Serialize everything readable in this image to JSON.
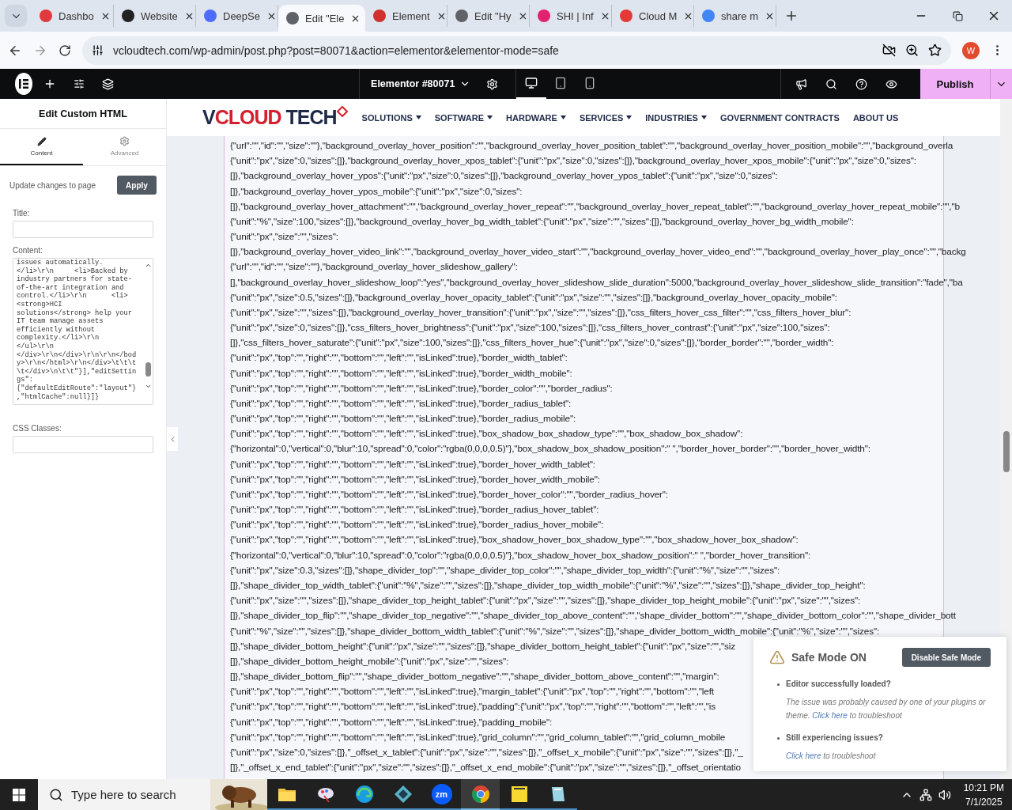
{
  "browser": {
    "tabs": [
      {
        "label": "Dashbo",
        "color": "#e0393e",
        "selected": false
      },
      {
        "label": "Website",
        "color": "#222222",
        "selected": false
      },
      {
        "label": "DeepSe",
        "color": "#4d6bfe",
        "selected": false
      },
      {
        "label": "Edit \"Ele",
        "color": "#5f6368",
        "selected": true
      },
      {
        "label": "Element",
        "color": "#d0312d",
        "selected": false
      },
      {
        "label": "Edit \"Hy",
        "color": "#5f6368",
        "selected": false
      },
      {
        "label": "SHI | Inf",
        "color": "#e2226f",
        "selected": false
      },
      {
        "label": "Cloud M",
        "color": "#e53935",
        "selected": false
      },
      {
        "label": "share m",
        "color": "#4285f4",
        "selected": false
      }
    ],
    "url": "vcloudtech.com/wp-admin/post.php?post=80071&action=elementor&elementor-mode=safe",
    "avatar": "W"
  },
  "editor_bar": {
    "document": "Elementor #80071",
    "devices": [
      {
        "kind": "desktop",
        "selected": true
      },
      {
        "kind": "tablet",
        "selected": false
      },
      {
        "kind": "mobile",
        "selected": false
      }
    ],
    "publish": "Publish"
  },
  "panel": {
    "title": "Edit Custom HTML",
    "tabs": [
      {
        "label": "Content",
        "kind": "pencil",
        "selected": true
      },
      {
        "label": "Advanced",
        "kind": "gear",
        "selected": false
      }
    ],
    "update_label": "Update changes to page",
    "apply": "Apply",
    "title_label": "Title:",
    "content_label": "Content:",
    "content_lines": [
      "issues automatically.",
      "</li>\\r\\n     <li>Backed by",
      "industry partners for state-",
      "of-the-art integration and",
      "control.</li>\\r\\n      <li>",
      "<strong>HCI",
      "solutions</strong> help your",
      "IT team manage assets",
      "efficiently without",
      "complexity.</li>\\r\\n",
      "</ul>\\r\\n",
      "</div>\\r\\n</div>\\r\\n\\r\\n</bod",
      "y>\\r\\n</html>\\r\\n</div>\\t\\t\\t",
      "\\t</div>\\n\\t\\t\"}],\"editSettin",
      "gs\":",
      "{\"defaultEditRoute\":\"layout\"}",
      ",\"htmlCache\":null}]}"
    ],
    "css_label": "CSS Classes:"
  },
  "site": {
    "logo": [
      {
        "text": "V",
        "color": "#1f2a48"
      },
      {
        "text": "CLOUD",
        "color": "#d4202e"
      },
      {
        "text": " TECH",
        "color": "#1f2a48"
      }
    ],
    "nav": [
      {
        "label": "SOLUTIONS",
        "dropdown": true
      },
      {
        "label": "SOFTWARE",
        "dropdown": true
      },
      {
        "label": "HARDWARE",
        "dropdown": true
      },
      {
        "label": "SERVICES",
        "dropdown": true
      },
      {
        "label": "INDUSTRIES",
        "dropdown": true
      },
      {
        "label": "GOVERNMENT CONTRACTS",
        "dropdown": false
      },
      {
        "label": "ABOUT US",
        "dropdown": false
      }
    ],
    "code_lines": [
      "{\"url\":\"\",\"id\":\"\",\"size\":\"\"},\"background_overlay_hover_position\":\"\",\"background_overlay_hover_position_tablet\":\"\",\"background_overlay_hover_position_mobile\":\"\",\"background_overla",
      "{\"unit\":\"px\",\"size\":0,\"sizes\":[]},\"background_overlay_hover_xpos_tablet\":{\"unit\":\"px\",\"size\":0,\"sizes\":[]},\"background_overlay_hover_xpos_mobile\":{\"unit\":\"px\",\"size\":0,\"sizes\":",
      "[]},\"background_overlay_hover_ypos\":{\"unit\":\"px\",\"size\":0,\"sizes\":[]},\"background_overlay_hover_ypos_tablet\":{\"unit\":\"px\",\"size\":0,\"sizes\":",
      "[]},\"background_overlay_hover_ypos_mobile\":{\"unit\":\"px\",\"size\":0,\"sizes\":",
      "[]},\"background_overlay_hover_attachment\":\"\",\"background_overlay_hover_repeat\":\"\",\"background_overlay_hover_repeat_tablet\":\"\",\"background_overlay_hover_repeat_mobile\":\"\",\"b",
      "{\"unit\":\"%\",\"size\":100,\"sizes\":[]},\"background_overlay_hover_bg_width_tablet\":{\"unit\":\"px\",\"size\":\"\",\"sizes\":[]},\"background_overlay_hover_bg_width_mobile\":",
      "{\"unit\":\"px\",\"size\":\"\",\"sizes\":",
      "[]},\"background_overlay_hover_video_link\":\"\",\"background_overlay_hover_video_start\":\"\",\"background_overlay_hover_video_end\":\"\",\"background_overlay_hover_play_once\":\"\",\"backg",
      "{\"url\":\"\",\"id\":\"\",\"size\":\"\"},\"background_overlay_hover_slideshow_gallery\":",
      "[],\"background_overlay_hover_slideshow_loop\":\"yes\",\"background_overlay_hover_slideshow_slide_duration\":5000,\"background_overlay_hover_slideshow_slide_transition\":\"fade\",\"ba",
      "{\"unit\":\"px\",\"size\":0.5,\"sizes\":[]},\"background_overlay_hover_opacity_tablet\":{\"unit\":\"px\",\"size\":\"\",\"sizes\":[]},\"background_overlay_hover_opacity_mobile\":",
      "{\"unit\":\"px\",\"size\":\"\",\"sizes\":[]},\"background_overlay_hover_transition\":{\"unit\":\"px\",\"size\":\"\",\"sizes\":[]},\"css_filters_hover_css_filter\":\"\",\"css_filters_hover_blur\":",
      "{\"unit\":\"px\",\"size\":0,\"sizes\":[]},\"css_filters_hover_brightness\":{\"unit\":\"px\",\"size\":100,\"sizes\":[]},\"css_filters_hover_contrast\":{\"unit\":\"px\",\"size\":100,\"sizes\":",
      "[]},\"css_filters_hover_saturate\":{\"unit\":\"px\",\"size\":100,\"sizes\":[]},\"css_filters_hover_hue\":{\"unit\":\"px\",\"size\":0,\"sizes\":[]},\"border_border\":\"\",\"border_width\":",
      "{\"unit\":\"px\",\"top\":\"\",\"right\":\"\",\"bottom\":\"\",\"left\":\"\",\"isLinked\":true},\"border_width_tablet\":",
      "{\"unit\":\"px\",\"top\":\"\",\"right\":\"\",\"bottom\":\"\",\"left\":\"\",\"isLinked\":true},\"border_width_mobile\":",
      "{\"unit\":\"px\",\"top\":\"\",\"right\":\"\",\"bottom\":\"\",\"left\":\"\",\"isLinked\":true},\"border_color\":\"\",\"border_radius\":",
      "{\"unit\":\"px\",\"top\":\"\",\"right\":\"\",\"bottom\":\"\",\"left\":\"\",\"isLinked\":true},\"border_radius_tablet\":",
      "{\"unit\":\"px\",\"top\":\"\",\"right\":\"\",\"bottom\":\"\",\"left\":\"\",\"isLinked\":true},\"border_radius_mobile\":",
      "{\"unit\":\"px\",\"top\":\"\",\"right\":\"\",\"bottom\":\"\",\"left\":\"\",\"isLinked\":true},\"box_shadow_box_shadow_type\":\"\",\"box_shadow_box_shadow\":",
      "{\"horizontal\":0,\"vertical\":0,\"blur\":10,\"spread\":0,\"color\":\"rgba(0,0,0,0.5)\"},\"box_shadow_box_shadow_position\":\" \",\"border_hover_border\":\"\",\"border_hover_width\":",
      "{\"unit\":\"px\",\"top\":\"\",\"right\":\"\",\"bottom\":\"\",\"left\":\"\",\"isLinked\":true},\"border_hover_width_tablet\":",
      "{\"unit\":\"px\",\"top\":\"\",\"right\":\"\",\"bottom\":\"\",\"left\":\"\",\"isLinked\":true},\"border_hover_width_mobile\":",
      "{\"unit\":\"px\",\"top\":\"\",\"right\":\"\",\"bottom\":\"\",\"left\":\"\",\"isLinked\":true},\"border_hover_color\":\"\",\"border_radius_hover\":",
      "{\"unit\":\"px\",\"top\":\"\",\"right\":\"\",\"bottom\":\"\",\"left\":\"\",\"isLinked\":true},\"border_radius_hover_tablet\":",
      "{\"unit\":\"px\",\"top\":\"\",\"right\":\"\",\"bottom\":\"\",\"left\":\"\",\"isLinked\":true},\"border_radius_hover_mobile\":",
      "{\"unit\":\"px\",\"top\":\"\",\"right\":\"\",\"bottom\":\"\",\"left\":\"\",\"isLinked\":true},\"box_shadow_hover_box_shadow_type\":\"\",\"box_shadow_hover_box_shadow\":",
      "{\"horizontal\":0,\"vertical\":0,\"blur\":10,\"spread\":0,\"color\":\"rgba(0,0,0,0.5)\"},\"box_shadow_hover_box_shadow_position\":\" \",\"border_hover_transition\":",
      "{\"unit\":\"px\",\"size\":0.3,\"sizes\":[]},\"shape_divider_top\":\"\",\"shape_divider_top_color\":\"\",\"shape_divider_top_width\":{\"unit\":\"%\",\"size\":\"\",\"sizes\":",
      "[]},\"shape_divider_top_width_tablet\":{\"unit\":\"%\",\"size\":\"\",\"sizes\":[]},\"shape_divider_top_width_mobile\":{\"unit\":\"%\",\"size\":\"\",\"sizes\":[]},\"shape_divider_top_height\":",
      "{\"unit\":\"px\",\"size\":\"\",\"sizes\":[]},\"shape_divider_top_height_tablet\":{\"unit\":\"px\",\"size\":\"\",\"sizes\":[]},\"shape_divider_top_height_mobile\":{\"unit\":\"px\",\"size\":\"\",\"sizes\":",
      "[]},\"shape_divider_top_flip\":\"\",\"shape_divider_top_negative\":\"\",\"shape_divider_top_above_content\":\"\",\"shape_divider_bottom\":\"\",\"shape_divider_bottom_color\":\"\",\"shape_divider_bott",
      "{\"unit\":\"%\",\"size\":\"\",\"sizes\":[]},\"shape_divider_bottom_width_tablet\":{\"unit\":\"%\",\"size\":\"\",\"sizes\":[]},\"shape_divider_bottom_width_mobile\":{\"unit\":\"%\",\"size\":\"\",\"sizes\":",
      "[]},\"shape_divider_bottom_height\":{\"unit\":\"px\",\"size\":\"\",\"sizes\":[]},\"shape_divider_bottom_height_tablet\":{\"unit\":\"px\",\"size\":\"\",\"siz",
      "[]},\"shape_divider_bottom_height_mobile\":{\"unit\":\"px\",\"size\":\"\",\"sizes\":",
      "[]},\"shape_divider_bottom_flip\":\"\",\"shape_divider_bottom_negative\":\"\",\"shape_divider_bottom_above_content\":\"\",\"margin\":",
      "{\"unit\":\"px\",\"top\":\"\",\"right\":\"\",\"bottom\":\"\",\"left\":\"\",\"isLinked\":true},\"margin_tablet\":{\"unit\":\"px\",\"top\":\"\",\"right\":\"\",\"bottom\":\"\",\"left",
      "{\"unit\":\"px\",\"top\":\"\",\"right\":\"\",\"bottom\":\"\",\"left\":\"\",\"isLinked\":true},\"padding\":{\"unit\":\"px\",\"top\":\"\",\"right\":\"\",\"bottom\":\"\",\"left\":\"\",\"is",
      "{\"unit\":\"px\",\"top\":\"\",\"right\":\"\",\"bottom\":\"\",\"left\":\"\",\"isLinked\":true},\"padding_mobile\":",
      "{\"unit\":\"px\",\"top\":\"\",\"right\":\"\",\"bottom\":\"\",\"left\":\"\",\"isLinked\":true},\"grid_column\":\"\",\"grid_column_tablet\":\"\",\"grid_column_mobile",
      "{\"unit\":\"px\",\"size\":0,\"sizes\":[]},\"_offset_x_tablet\":{\"unit\":\"px\",\"size\":\"\",\"sizes\":[]},\"_offset_x_mobile\":{\"unit\":\"px\",\"size\":\"\",\"sizes\":[]},\"_",
      "[]},\"_offset_x_end_tablet\":{\"unit\":\"px\",\"size\":\"\",\"sizes\":[]},\"_offset_x_end_mobile\":{\"unit\":\"px\",\"size\":\"\",\"sizes\":[]},\"_offset_orientatio"
    ]
  },
  "safe_mode": {
    "title": "Safe Mode ON",
    "button": "Disable Safe Mode",
    "items": [
      {
        "heading": "Editor successfully loaded?",
        "text": "The issue was probably caused by one of your plugins or theme.",
        "link": "Click here",
        "after": "to troubleshoot"
      },
      {
        "heading": "Still experiencing issues?",
        "link": "Click here",
        "after": "to troubleshoot"
      }
    ]
  },
  "taskbar": {
    "search_placeholder": "Type here to search",
    "apps": [
      {
        "kind": "folder",
        "selected": false
      },
      {
        "kind": "paint",
        "selected": false
      },
      {
        "kind": "edge",
        "selected": false
      },
      {
        "kind": "gem",
        "selected": false
      },
      {
        "kind": "zoom",
        "label": "zm",
        "selected": false
      },
      {
        "kind": "chrome",
        "selected": true
      },
      {
        "kind": "notes",
        "selected": false
      },
      {
        "kind": "glass",
        "selected": false
      }
    ],
    "time": "10:21 PM",
    "date": "7/1/2025"
  }
}
